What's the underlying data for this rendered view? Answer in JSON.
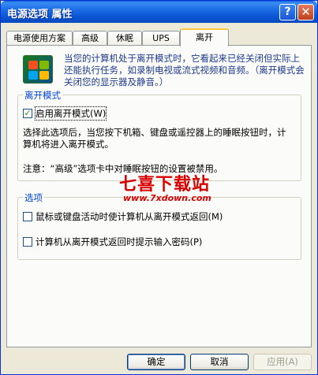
{
  "window": {
    "title": "电源选项 属性",
    "help_glyph": "?",
    "close_glyph": "✕"
  },
  "tabs": [
    {
      "label": "电源使用方案",
      "active": false
    },
    {
      "label": "高级",
      "active": false
    },
    {
      "label": "休眠",
      "active": false
    },
    {
      "label": "UPS",
      "active": false
    },
    {
      "label": "离开",
      "active": true
    }
  ],
  "intro": {
    "icon": "windows-xp-logo-icon",
    "text": "当您的计算机处于离开模式时，它看起来已经关闭但实际上还能执行任务，如录制电视或流式视频和音频。（离开模式会关闭您的显示器及静音。）"
  },
  "away_mode": {
    "group_title": "离开模式",
    "enable_label": "启用离开模式(W)",
    "enable_checked": true,
    "description": "选择此选项后，当您按下机箱、键盘或遥控器上的睡眠按钮时，计算机将进入离开模式。",
    "note": "注意：“高级”选项卡中对睡眠按钮的设置被禁用。"
  },
  "options": {
    "group_title": "选项",
    "items": [
      {
        "label": "鼠标或键盘活动时使计算机从离开模式返回(M)",
        "checked": false
      },
      {
        "label": "计算机从离开模式返回时提示输入密码(P)",
        "checked": false
      }
    ]
  },
  "watermark": {
    "title": "七喜下载站",
    "url": "www.7xdown.com"
  },
  "buttons": {
    "ok": "确定",
    "cancel": "取消",
    "apply": "应用(A)"
  }
}
